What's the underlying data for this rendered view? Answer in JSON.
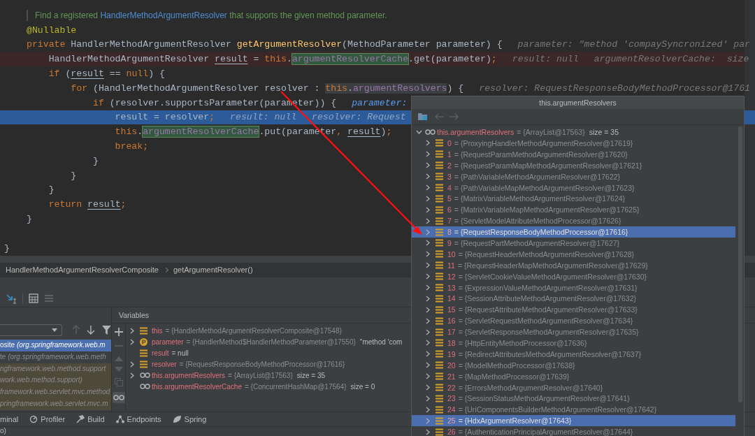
{
  "editor": {
    "lines": [
      {
        "kind": "doc",
        "error": false,
        "current": false,
        "tokens": [
          {
            "kind": "doc",
            "text": "Find a registered "
          },
          {
            "kind": "doc-link",
            "text": "HandlerMethodArgumentResolver"
          },
          {
            "kind": "doc",
            "text": " that supports the given method parameter."
          }
        ]
      },
      {
        "kind": "code",
        "error": false,
        "current": false,
        "tokens": [
          {
            "kind": "ann",
            "text": "@Nullable"
          }
        ]
      },
      {
        "kind": "code",
        "error": false,
        "current": false,
        "tokens": [
          {
            "kind": "kw",
            "text": "private "
          },
          {
            "kind": "plain",
            "text": "HandlerMethodArgumentResolver "
          },
          {
            "kind": "fn",
            "text": "getArgumentResolver"
          },
          {
            "kind": "plain",
            "text": "(MethodParameter parameter) {"
          }
        ],
        "hints": [
          {
            "text": "parameter: \"method 'compaySyncronized' par",
            "active": false
          }
        ]
      },
      {
        "kind": "code",
        "error": true,
        "current": false,
        "tokens": [
          {
            "kind": "plain",
            "text": "    HandlerMethodArgumentResolver "
          },
          {
            "kind": "var",
            "text": "result"
          },
          {
            "kind": "plain",
            "text": " = "
          },
          {
            "kind": "kw",
            "text": "this"
          },
          {
            "kind": "plain",
            "text": "."
          },
          {
            "kind": "cache",
            "text": "argumentResolverCache"
          },
          {
            "kind": "plain",
            "text": ".get(parameter)"
          },
          {
            "kind": "kw",
            "text": ";"
          }
        ],
        "hints": [
          {
            "text": "result: null",
            "active": false
          },
          {
            "text": "argumentResolverCache:  size",
            "active": false
          }
        ]
      },
      {
        "kind": "code",
        "error": false,
        "current": false,
        "tokens": [
          {
            "kind": "kw",
            "text": "    if "
          },
          {
            "kind": "plain",
            "text": "("
          },
          {
            "kind": "var",
            "text": "result"
          },
          {
            "kind": "plain",
            "text": " == "
          },
          {
            "kind": "kw",
            "text": "null"
          },
          {
            "kind": "plain",
            "text": ") {"
          }
        ]
      },
      {
        "kind": "code",
        "error": false,
        "current": false,
        "tokens": [
          {
            "kind": "kw",
            "text": "        for "
          },
          {
            "kind": "plain",
            "text": "(HandlerMethodArgumentResolver resolver : "
          },
          {
            "kind": "kw-sel",
            "text": "this"
          },
          {
            "kind": "plain-sel",
            "text": "."
          },
          {
            "kind": "field-sel",
            "text": "argumentResolvers"
          },
          {
            "kind": "plain",
            "text": ") {"
          }
        ],
        "hints": [
          {
            "text": "resolver: RequestResponseBodyMethodProcessor@1761",
            "active": false
          }
        ]
      },
      {
        "kind": "code",
        "error": false,
        "current": false,
        "tokens": [
          {
            "kind": "kw",
            "text": "            if "
          },
          {
            "kind": "plain",
            "text": "(resolver.supportsParameter(parameter)) {"
          }
        ],
        "hints": [
          {
            "text": "parameter:",
            "active": true
          }
        ]
      },
      {
        "kind": "code",
        "error": false,
        "current": true,
        "tokens": [
          {
            "kind": "plain",
            "text": "                result = resolver"
          },
          {
            "kind": "kw",
            "text": ";"
          }
        ],
        "hints": [
          {
            "text": "result: null",
            "active": false
          },
          {
            "text": "resolver: Request",
            "active": false
          }
        ]
      },
      {
        "kind": "code",
        "error": false,
        "current": false,
        "tokens": [
          {
            "kind": "kw",
            "text": "                this"
          },
          {
            "kind": "plain",
            "text": "."
          },
          {
            "kind": "cache",
            "text": "argumentResolverCache"
          },
          {
            "kind": "plain",
            "text": ".put(parameter"
          },
          {
            "kind": "kw",
            "text": ", "
          },
          {
            "kind": "var",
            "text": "result"
          },
          {
            "kind": "plain",
            "text": ")"
          },
          {
            "kind": "kw",
            "text": ";"
          }
        ]
      },
      {
        "kind": "code",
        "error": false,
        "current": false,
        "tokens": [
          {
            "kind": "kw",
            "text": "                break;"
          }
        ]
      },
      {
        "kind": "code",
        "error": false,
        "current": false,
        "tokens": [
          {
            "kind": "plain",
            "text": "            }"
          }
        ]
      },
      {
        "kind": "code",
        "error": false,
        "current": false,
        "tokens": [
          {
            "kind": "plain",
            "text": "        }"
          }
        ]
      },
      {
        "kind": "code",
        "error": false,
        "current": false,
        "tokens": [
          {
            "kind": "plain",
            "text": "    }"
          }
        ]
      },
      {
        "kind": "code",
        "error": false,
        "current": false,
        "tokens": [
          {
            "kind": "kw",
            "text": "    return "
          },
          {
            "kind": "var",
            "text": "result"
          },
          {
            "kind": "kw",
            "text": ";"
          }
        ]
      },
      {
        "kind": "code",
        "error": false,
        "current": false,
        "tokens": [
          {
            "kind": "plain",
            "text": "}"
          }
        ]
      },
      {
        "kind": "outer",
        "error": false,
        "current": false,
        "tokens": [
          {
            "kind": "plain",
            "text": "}"
          }
        ]
      }
    ]
  },
  "breadcrumb": [
    "HandlerMethodArgumentResolverComposite",
    "getArgumentResolver()"
  ],
  "frames": {
    "items": [
      {
        "kind": "current",
        "text": "osite *(org.springframework.web.m*"
      },
      {
        "kind": "normal",
        "text": "te *(org.springframework.web.meth*"
      },
      {
        "kind": "library",
        "text": "ngframework.web.method.support"
      },
      {
        "kind": "library",
        "text": "work.web.method.support)"
      },
      {
        "kind": "library",
        "text": "framework.web.servlet.mvc.method"
      },
      {
        "kind": "library",
        "text": "pringframework.web.servlet.mvc.m"
      }
    ]
  },
  "variables": {
    "title": "Variables",
    "items": [
      {
        "kind": "field",
        "name": "this",
        "value": "= {HandlerMethodArgumentResolverComposite@17548}",
        "literal": false,
        "expandable": true
      },
      {
        "kind": "param",
        "name": "parameter",
        "value": "= {HandlerMethod$HandlerMethodParameter@17550}",
        "literal": false,
        "extra": "\"method 'com",
        "expandable": true
      },
      {
        "kind": "field",
        "name": "result",
        "value": "= null",
        "literal": true,
        "expandable": false
      },
      {
        "kind": "field",
        "name": "resolver",
        "value": "= {RequestResponseBodyMethodProcessor@17616}",
        "literal": false,
        "expandable": true
      },
      {
        "kind": "watch",
        "name": "this.argumentResolvers",
        "value": "= {ArrayList@17563}",
        "literal": false,
        "extra": "size = 35",
        "expandable": true
      },
      {
        "kind": "watch",
        "name": "this.argumentResolverCache",
        "value": "= {ConcurrentHashMap@17564}",
        "literal": false,
        "extra": "size = 0",
        "expandable": false
      }
    ]
  },
  "popup": {
    "title": "this.argumentResolvers",
    "root": {
      "name": "this.argumentResolvers",
      "value": "= {ArrayList@17563}",
      "extra": "size = 35",
      "expanded": true
    },
    "items": [
      {
        "name": "0",
        "value": "= {ProxyingHandlerMethodArgumentResolver@17619}",
        "selected": false
      },
      {
        "name": "1",
        "value": "= {RequestParamMethodArgumentResolver@17620}",
        "selected": false
      },
      {
        "name": "2",
        "value": "= {RequestParamMapMethodArgumentResolver@17621}",
        "selected": false
      },
      {
        "name": "3",
        "value": "= {PathVariableMethodArgumentResolver@17622}",
        "selected": false
      },
      {
        "name": "4",
        "value": "= {PathVariableMapMethodArgumentResolver@17623}",
        "selected": false
      },
      {
        "name": "5",
        "value": "= {MatrixVariableMethodArgumentResolver@17624}",
        "selected": false
      },
      {
        "name": "6",
        "value": "= {MatrixVariableMapMethodArgumentResolver@17625}",
        "selected": false
      },
      {
        "name": "7",
        "value": "= {ServletModelAttributeMethodProcessor@17626}",
        "selected": false
      },
      {
        "name": "8",
        "value": "= {RequestResponseBodyMethodProcessor@17616}",
        "selected": true
      },
      {
        "name": "9",
        "value": "= {RequestPartMethodArgumentResolver@17627}",
        "selected": false
      },
      {
        "name": "10",
        "value": "= {RequestHeaderMethodArgumentResolver@17628}",
        "selected": false
      },
      {
        "name": "11",
        "value": "= {RequestHeaderMapMethodArgumentResolver@17629}",
        "selected": false
      },
      {
        "name": "12",
        "value": "= {ServletCookieValueMethodArgumentResolver@17630}",
        "selected": false
      },
      {
        "name": "13",
        "value": "= {ExpressionValueMethodArgumentResolver@17631}",
        "selected": false
      },
      {
        "name": "14",
        "value": "= {SessionAttributeMethodArgumentResolver@17632}",
        "selected": false
      },
      {
        "name": "15",
        "value": "= {RequestAttributeMethodArgumentResolver@17633}",
        "selected": false
      },
      {
        "name": "16",
        "value": "= {ServletRequestMethodArgumentResolver@17634}",
        "selected": false
      },
      {
        "name": "17",
        "value": "= {ServletResponseMethodArgumentResolver@17635}",
        "selected": false
      },
      {
        "name": "18",
        "value": "= {HttpEntityMethodProcessor@17636}",
        "selected": false
      },
      {
        "name": "19",
        "value": "= {RedirectAttributesMethodArgumentResolver@17637}",
        "selected": false
      },
      {
        "name": "20",
        "value": "= {ModelMethodProcessor@17638}",
        "selected": false
      },
      {
        "name": "21",
        "value": "= {MapMethodProcessor@17639}",
        "selected": false
      },
      {
        "name": "22",
        "value": "= {ErrorsMethodArgumentResolver@17640}",
        "selected": false
      },
      {
        "name": "23",
        "value": "= {SessionStatusMethodArgumentResolver@17641}",
        "selected": false
      },
      {
        "name": "24",
        "value": "= {UriComponentsBuilderMethodArgumentResolver@17642}",
        "selected": false
      },
      {
        "name": "25",
        "value": "= {HdxArgumentResolver@17643}",
        "selected": true
      },
      {
        "name": "26",
        "value": "= {AuthenticationPrincipalArgumentResolver@17644}",
        "selected": false
      }
    ]
  },
  "tool_windows": [
    {
      "kind": "terminal",
      "label": "minal"
    },
    {
      "kind": "profiler",
      "label": "Profiler"
    },
    {
      "kind": "build",
      "label": "Build"
    },
    {
      "kind": "endpoints",
      "label": "Endpoints"
    },
    {
      "kind": "spring",
      "label": "Spring"
    }
  ],
  "status_bar": {
    "text": "o)"
  }
}
